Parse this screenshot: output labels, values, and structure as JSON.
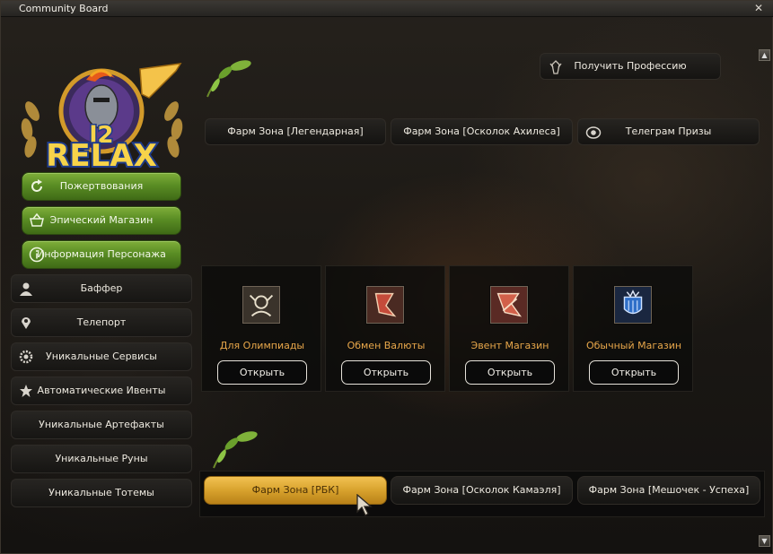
{
  "window": {
    "title": "Community Board",
    "close": "✕"
  },
  "logo": {
    "text_top": "l2",
    "text_main": "RELAX"
  },
  "menu_green": [
    {
      "label": "Пожертвования",
      "icon": "refresh-icon"
    },
    {
      "label": "Эпический Магазин",
      "icon": "basket-icon"
    },
    {
      "label": "Информация Персонажа",
      "icon": "info-icon"
    }
  ],
  "menu_dark": [
    {
      "label": "Баффер",
      "icon": "person-icon"
    },
    {
      "label": "Телепорт",
      "icon": "location-pin-icon"
    },
    {
      "label": "Уникальные Сервисы",
      "icon": "gear-icon"
    },
    {
      "label": "Автоматические Ивенты",
      "icon": "star-icon"
    },
    {
      "label": "Уникальные Артефакты",
      "icon": ""
    },
    {
      "label": "Уникальные Руны",
      "icon": ""
    },
    {
      "label": "Уникальные Тотемы",
      "icon": ""
    }
  ],
  "top_buttons": {
    "profession": "Получить Профессию",
    "farm_legendary": "Фарм Зона [Легендарная]",
    "farm_achilles": "Фарм Зона [Осколок Ахилеса]",
    "telegram": "Телеграм Призы"
  },
  "shops": [
    {
      "label": "Для Олимпиады",
      "button": "Открыть",
      "icon": "olympiad-crest-icon"
    },
    {
      "label": "Обмен Валюты",
      "button": "Открыть",
      "icon": "currency-exchange-icon"
    },
    {
      "label": "Эвент Магазин",
      "button": "Открыть",
      "icon": "event-shop-icon"
    },
    {
      "label": "Обычный Магазин",
      "button": "Открыть",
      "icon": "shop-crest-icon"
    }
  ],
  "bottom_buttons": {
    "rbk": "Фарм Зона [РБК]",
    "kamael": "Фарм Зона [Осколок Камаэля]",
    "pouch": "Фарм Зона [Мешочек - Успеха]"
  },
  "colors": {
    "green_button": "#5a8d24",
    "gold_active": "#d8a22d",
    "shop_label": "#e8a74a"
  }
}
